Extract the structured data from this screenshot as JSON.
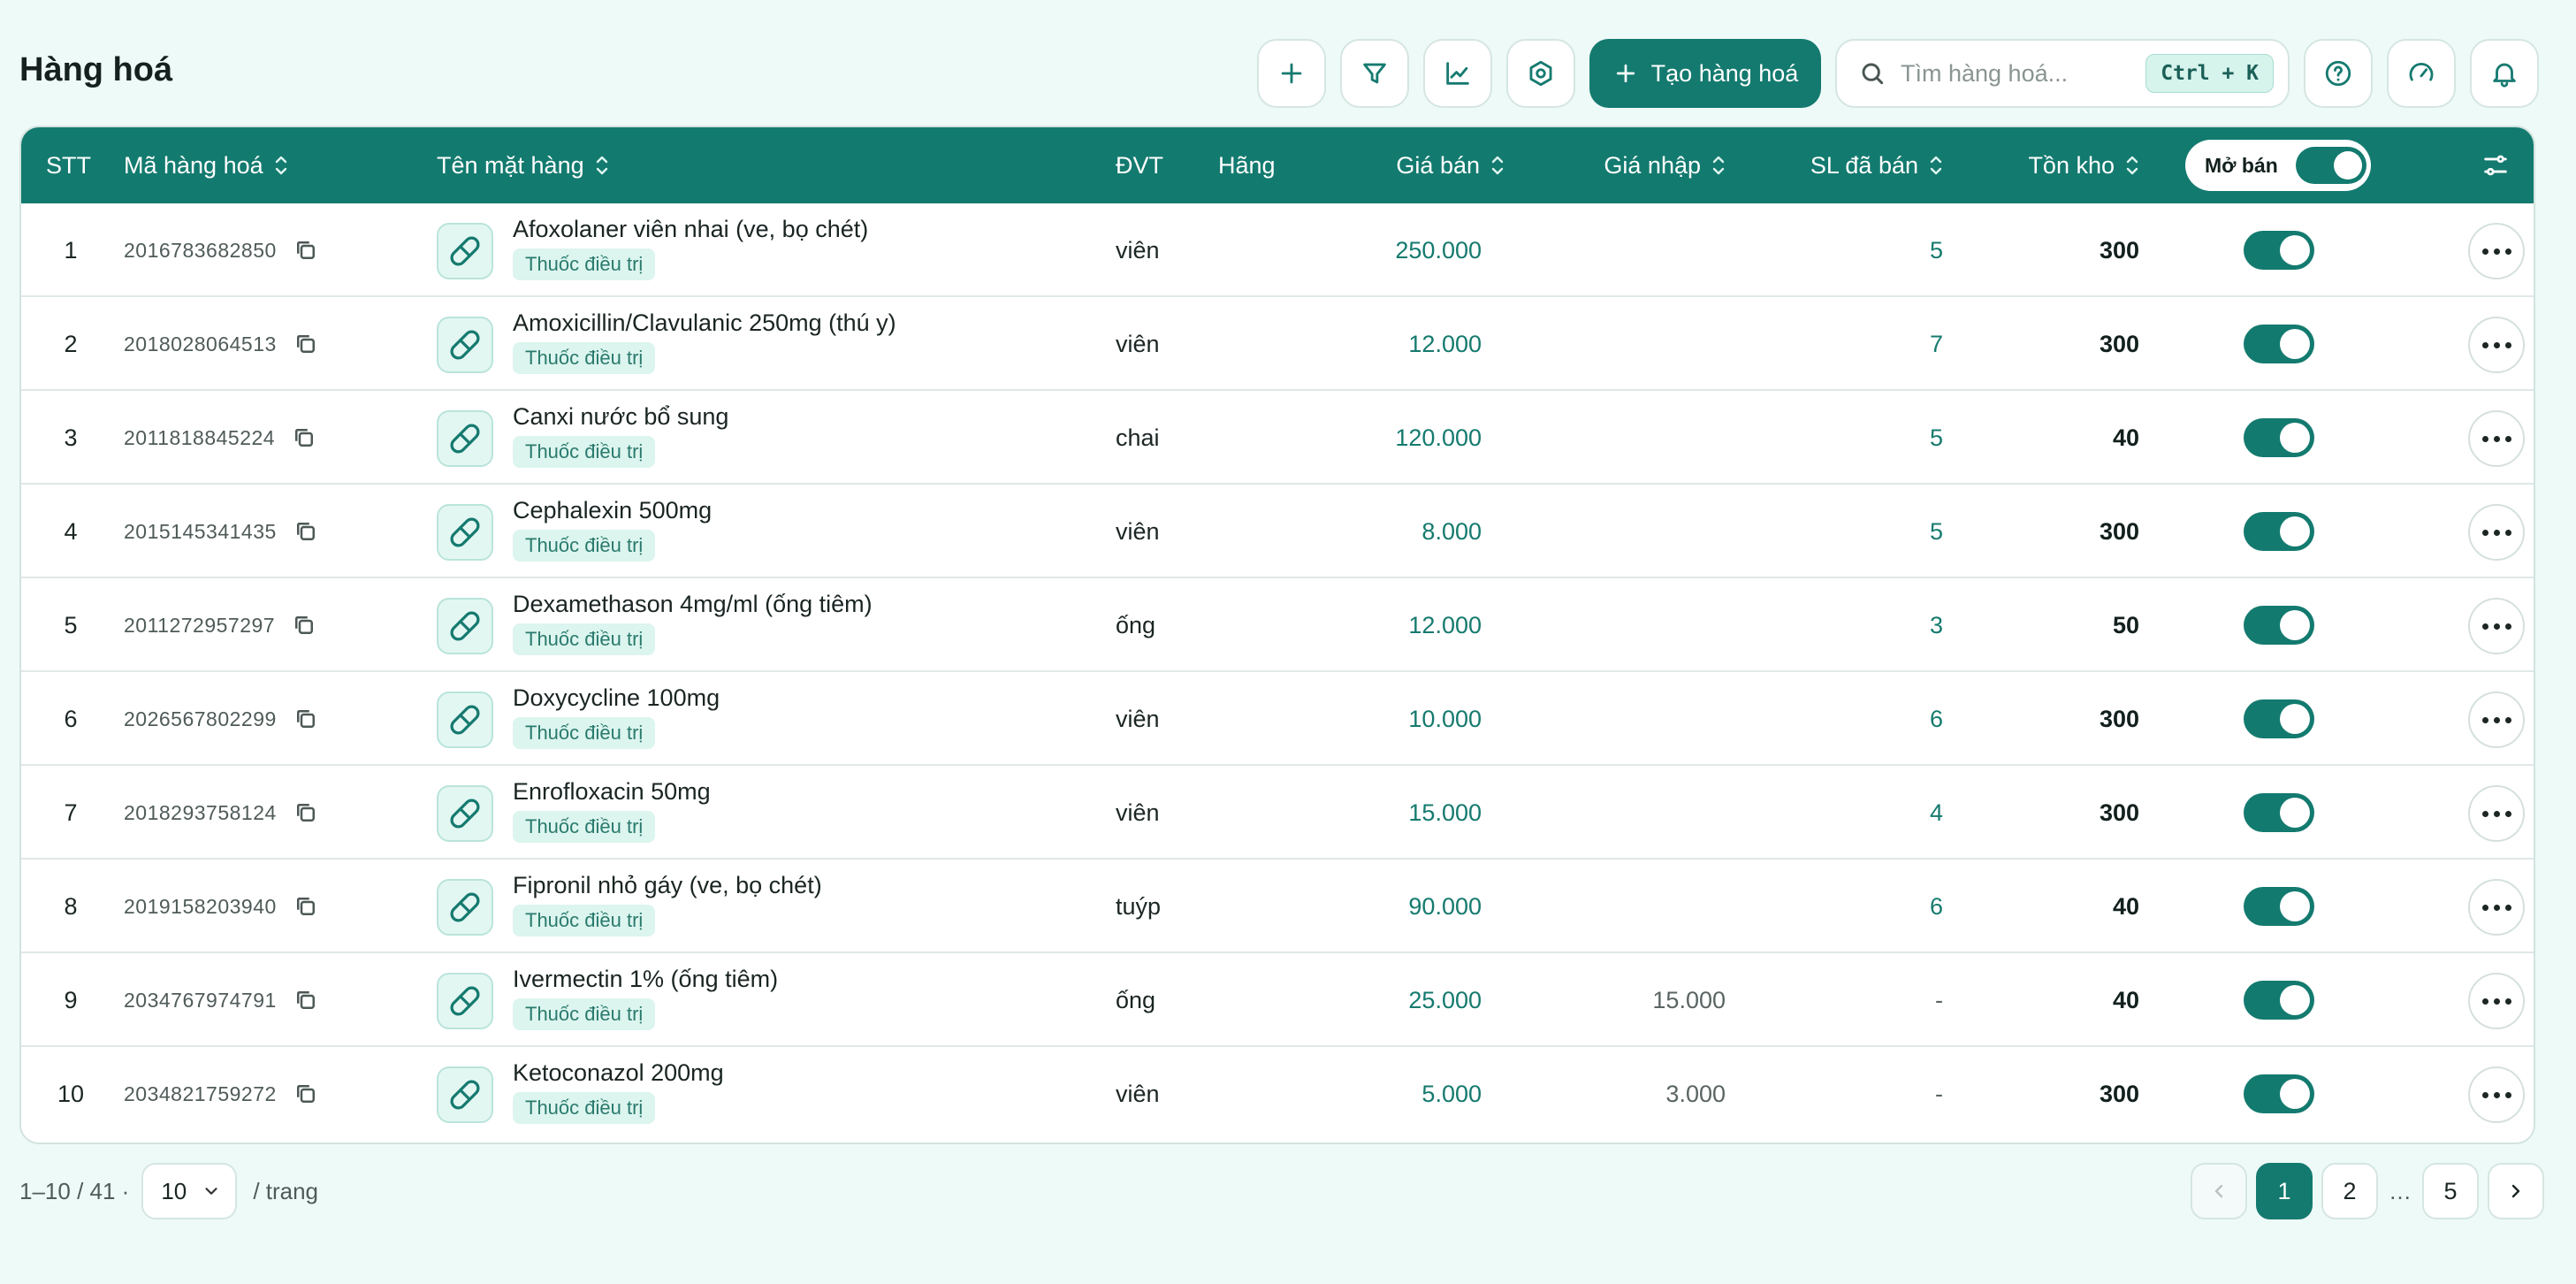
{
  "header": {
    "title": "Hàng hoá",
    "create_label": "Tạo hàng hoá",
    "search_placeholder": "Tìm hàng hoá...",
    "search_shortcut": "Ctrl + K"
  },
  "table": {
    "columns": {
      "stt": "STT",
      "code": "Mã hàng hoá",
      "name": "Tên mặt hàng",
      "unit": "ĐVT",
      "brand": "Hãng",
      "price": "Giá bán",
      "import_price": "Giá nhập",
      "sold": "SL đã bán",
      "stock": "Tồn kho",
      "open_sale": "Mở bán"
    },
    "rows": [
      {
        "stt": "1",
        "code": "2016783682850",
        "name": "Afoxolaner viên nhai (ve, bọ chét)",
        "tag": "Thuốc điều trị",
        "unit": "viên",
        "price": "250.000",
        "import_price": "",
        "sold": "5",
        "stock": "300",
        "open_sale": true
      },
      {
        "stt": "2",
        "code": "2018028064513",
        "name": "Amoxicillin/Clavulanic 250mg (thú y)",
        "tag": "Thuốc điều trị",
        "unit": "viên",
        "price": "12.000",
        "import_price": "",
        "sold": "7",
        "stock": "300",
        "open_sale": true
      },
      {
        "stt": "3",
        "code": "2011818845224",
        "name": "Canxi nước bổ sung",
        "tag": "Thuốc điều trị",
        "unit": "chai",
        "price": "120.000",
        "import_price": "",
        "sold": "5",
        "stock": "40",
        "open_sale": true
      },
      {
        "stt": "4",
        "code": "2015145341435",
        "name": "Cephalexin 500mg",
        "tag": "Thuốc điều trị",
        "unit": "viên",
        "price": "8.000",
        "import_price": "",
        "sold": "5",
        "stock": "300",
        "open_sale": true
      },
      {
        "stt": "5",
        "code": "2011272957297",
        "name": "Dexamethason 4mg/ml (ống tiêm)",
        "tag": "Thuốc điều trị",
        "unit": "ống",
        "price": "12.000",
        "import_price": "",
        "sold": "3",
        "stock": "50",
        "open_sale": true
      },
      {
        "stt": "6",
        "code": "2026567802299",
        "name": "Doxycycline 100mg",
        "tag": "Thuốc điều trị",
        "unit": "viên",
        "price": "10.000",
        "import_price": "",
        "sold": "6",
        "stock": "300",
        "open_sale": true
      },
      {
        "stt": "7",
        "code": "2018293758124",
        "name": "Enrofloxacin 50mg",
        "tag": "Thuốc điều trị",
        "unit": "viên",
        "price": "15.000",
        "import_price": "",
        "sold": "4",
        "stock": "300",
        "open_sale": true
      },
      {
        "stt": "8",
        "code": "2019158203940",
        "name": "Fipronil nhỏ gáy (ve, bọ chét)",
        "tag": "Thuốc điều trị",
        "unit": "tuýp",
        "price": "90.000",
        "import_price": "",
        "sold": "6",
        "stock": "40",
        "open_sale": true
      },
      {
        "stt": "9",
        "code": "2034767974791",
        "name": "Ivermectin 1% (ống tiêm)",
        "tag": "Thuốc điều trị",
        "unit": "ống",
        "price": "25.000",
        "import_price": "15.000",
        "sold": "-",
        "stock": "40",
        "open_sale": true
      },
      {
        "stt": "10",
        "code": "2034821759272",
        "name": "Ketoconazol 200mg",
        "tag": "Thuốc điều trị",
        "unit": "viên",
        "price": "5.000",
        "import_price": "3.000",
        "sold": "-",
        "stock": "300",
        "open_sale": true
      }
    ]
  },
  "footer": {
    "range": "1–10 / 41 ·",
    "page_size": "10",
    "per_page": "/ trang",
    "pages": [
      "1",
      "2",
      "…",
      "5"
    ],
    "current_page": "1"
  },
  "colors": {
    "accent": "#147a6f",
    "background": "#eefaf8",
    "tag_background": "#dcf5ee"
  },
  "icons": {
    "toolbar": [
      "plus-icon",
      "filter-icon",
      "chart-icon",
      "settings-icon",
      "plus-icon",
      "search-icon",
      "help-icon",
      "gauge-icon",
      "bell-icon"
    ],
    "row": [
      "copy-icon",
      "pill-icon",
      "more-icon"
    ]
  }
}
